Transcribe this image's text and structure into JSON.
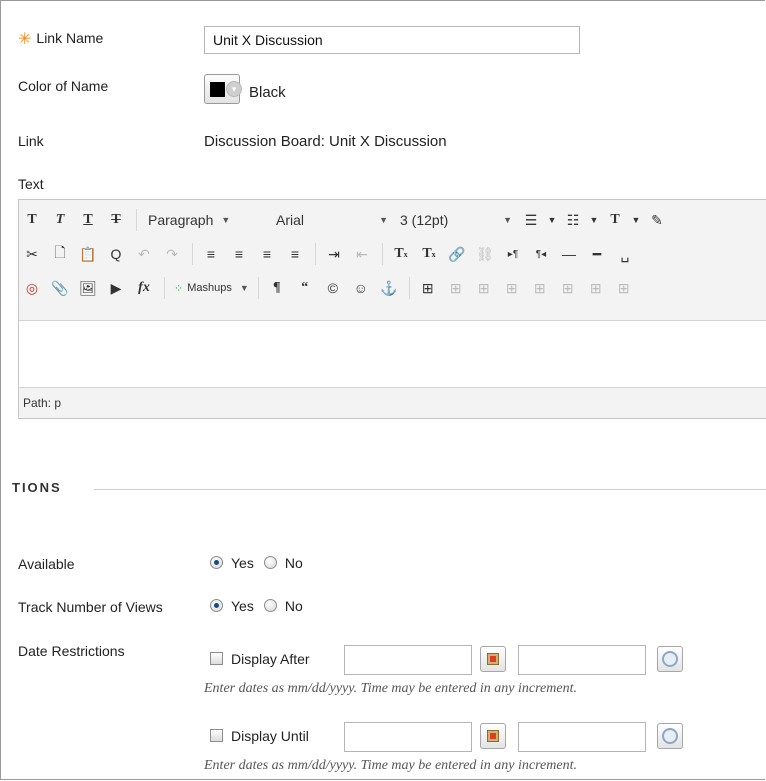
{
  "form": {
    "link_name": {
      "label": "Link Name",
      "value": "Unit X Discussion",
      "required_mark": "✳"
    },
    "color": {
      "label": "Color of Name",
      "value": "Black",
      "swatch": "#000000"
    },
    "link": {
      "label": "Link",
      "value": "Discussion Board: Unit X Discussion"
    },
    "text": {
      "label": "Text"
    }
  },
  "editor": {
    "row1": {
      "format_buttons": [
        "T",
        "T",
        "T",
        "T"
      ],
      "paragraph": "Paragraph",
      "font": "Arial",
      "size": "3 (12pt)",
      "list1": "☰",
      "list2": "☷",
      "text_color": "T",
      "highlight": "✎"
    },
    "row2": [
      "✂",
      "🗋",
      "📋",
      "Q",
      "↶",
      "↷",
      "≡",
      "≡",
      "≡",
      "≡",
      "⇥",
      "⇤",
      "T",
      "T",
      "🔗",
      "⛓",
      "▸¶",
      "¶◂",
      "—",
      "━",
      "␣"
    ],
    "row3": [
      "◎",
      "📎",
      "🖼",
      "▶",
      "fx"
    ],
    "mashups": "Mashups",
    "row3b": [
      "¶",
      "“",
      "©",
      "☺",
      "⚓",
      "⊞",
      "⊞",
      "⊞",
      "⊞",
      "⊞",
      "⊞",
      "⊞",
      "⊞"
    ],
    "path_label": "Path:",
    "path_value": "p"
  },
  "options": {
    "section_title": "TIONS",
    "available": {
      "label": "Available",
      "yes": "Yes",
      "no": "No",
      "selected": "Yes"
    },
    "track_views": {
      "label": "Track Number of Views",
      "yes": "Yes",
      "no": "No",
      "selected": "Yes"
    },
    "date_restrictions": {
      "label": "Date Restrictions",
      "after_label": "Display After",
      "until_label": "Display Until",
      "hint": "Enter dates as mm/dd/yyyy. Time may be entered in any increment."
    }
  }
}
